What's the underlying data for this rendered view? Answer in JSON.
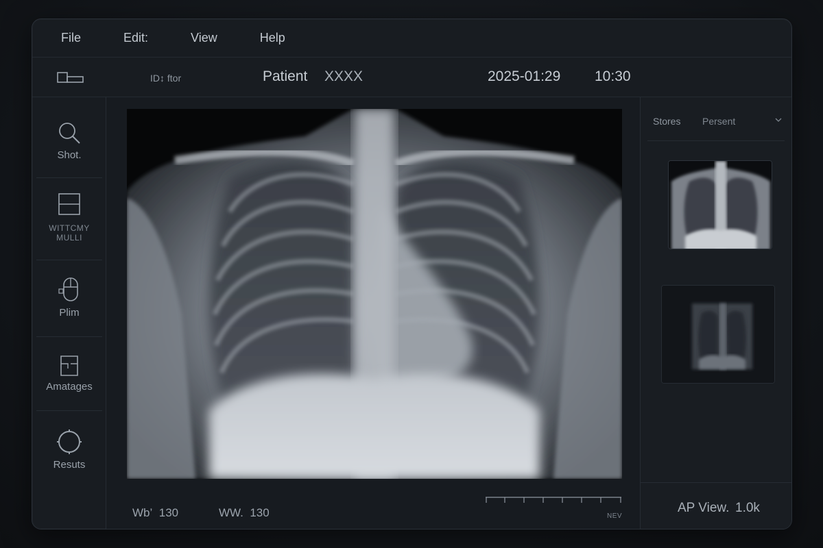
{
  "menu": {
    "items": [
      {
        "label": "File"
      },
      {
        "label": "Edit:"
      },
      {
        "label": "View"
      },
      {
        "label": "Help"
      }
    ]
  },
  "toolbar": {
    "id_label": "ID↕ ftor",
    "patient_label": "Patient",
    "patient_id": "XXXX",
    "date": "2025-01:29",
    "time": "10:30"
  },
  "sidebar": {
    "items": [
      {
        "label": "Shot.",
        "icon": "magnifier-icon"
      },
      {
        "label": "WITTCMY\nMULLI",
        "icon": "split-view-icon"
      },
      {
        "label": "Plim",
        "icon": "mouse-icon"
      },
      {
        "label": "Amatages",
        "icon": "frame-icon"
      },
      {
        "label": "Resuts",
        "icon": "circle-icon"
      }
    ]
  },
  "viewer": {
    "image_desc": "chest-xray",
    "wl_label": "Wb’",
    "wl_value": "130",
    "ww_label": "WW.",
    "ww_value": "130",
    "scale_label": "NEV"
  },
  "rightpanel": {
    "stores_label": "Stores",
    "filter_value": "Persent",
    "view_label": "AP View.",
    "size_label": "1.0k"
  },
  "colors": {
    "background": "#121519",
    "panel": "#181c21",
    "border": "#262c33",
    "text": "#b9c0c8"
  }
}
